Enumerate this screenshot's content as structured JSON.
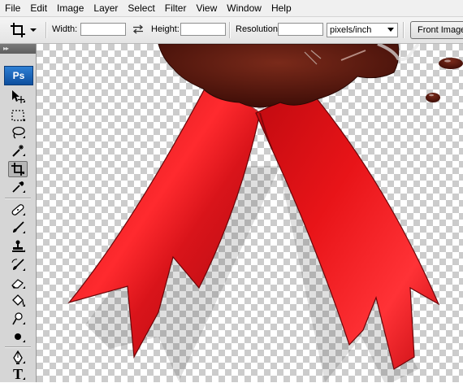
{
  "menubar": {
    "items": [
      "File",
      "Edit",
      "Image",
      "Layer",
      "Select",
      "Filter",
      "View",
      "Window",
      "Help"
    ]
  },
  "options": {
    "tool_icon": "crop-icon",
    "width_label": "Width:",
    "width_value": "",
    "swap_icon": "swap-arrows-icon",
    "height_label": "Height:",
    "height_value": "",
    "resolution_label": "Resolution:",
    "resolution_value": "",
    "units_selected": "pixels/inch",
    "front_image_label": "Front Image"
  },
  "toolbox": {
    "logo": "Ps",
    "tools": [
      {
        "name": "move-tool-icon"
      },
      {
        "name": "marquee-tool-icon"
      },
      {
        "name": "lasso-tool-icon"
      },
      {
        "name": "magic-wand-tool-icon"
      },
      {
        "name": "crop-tool-icon",
        "active": true
      },
      {
        "name": "eyedropper-tool-icon"
      },
      {
        "name": "healing-brush-tool-icon"
      },
      {
        "name": "brush-tool-icon"
      },
      {
        "name": "clone-stamp-tool-icon"
      },
      {
        "name": "history-brush-tool-icon"
      },
      {
        "name": "eraser-tool-icon"
      },
      {
        "name": "paint-bucket-tool-icon"
      },
      {
        "name": "dodge-tool-icon"
      },
      {
        "name": "blur-tool-icon"
      },
      {
        "name": "pen-tool-icon"
      },
      {
        "name": "type-tool-icon"
      }
    ],
    "type_glyph": "T"
  },
  "colors": {
    "ribbon_red": "#e0141c",
    "ribbon_dark": "#8a0a0e",
    "wax_brown": "#5a1a10",
    "ps_blue": "#1b63b8"
  }
}
